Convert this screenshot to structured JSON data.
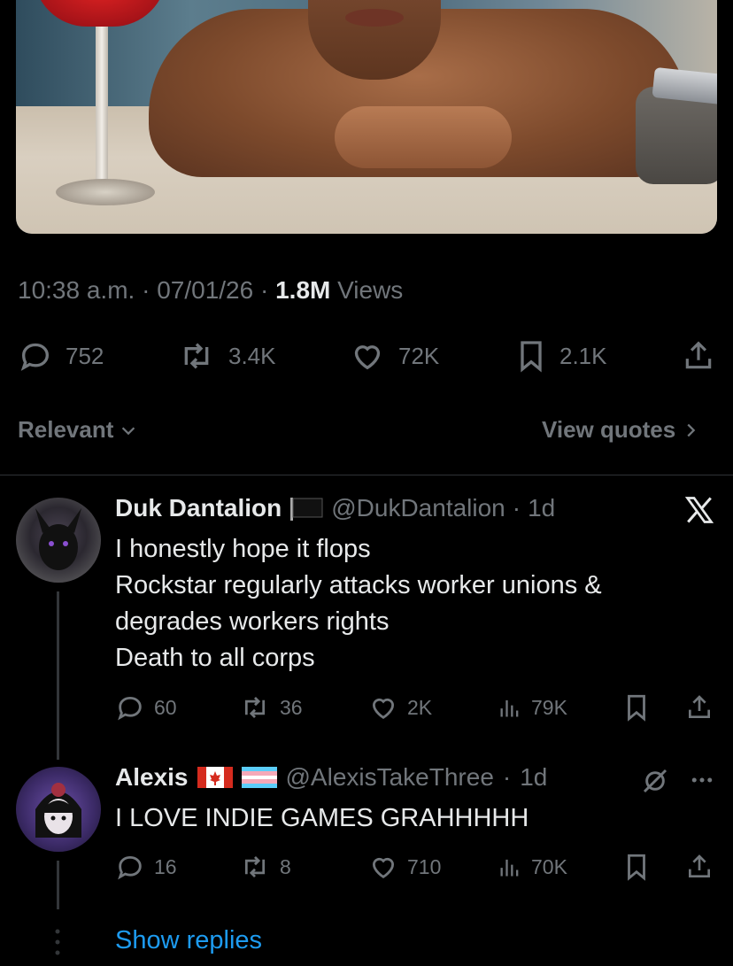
{
  "tweet": {
    "time": "10:38 a.m.",
    "date": "07/01/26",
    "views_count": "1.8M",
    "views_label": "Views",
    "actions": {
      "replies": "752",
      "reposts": "3.4K",
      "likes": "72K",
      "bookmarks": "2.1K"
    }
  },
  "sort": {
    "label": "Relevant",
    "view_quotes": "View quotes"
  },
  "replies": [
    {
      "name": "Duk Dantalion",
      "handle": "@DukDantalion",
      "age": "1d",
      "lines": [
        "I honestly hope it flops",
        "Rockstar regularly attacks worker unions &",
        "degrades workers rights",
        "Death to all corps"
      ],
      "actions": {
        "replies": "60",
        "reposts": "36",
        "likes": "2K",
        "views": "79K"
      }
    },
    {
      "name": "Alexis",
      "handle": "@AlexisTakeThree",
      "age": "1d",
      "lines": [
        "I LOVE INDIE GAMES GRAHHHHH"
      ],
      "actions": {
        "replies": "16",
        "reposts": "8",
        "likes": "710",
        "views": "70K"
      }
    }
  ],
  "show_replies": "Show replies",
  "icons": [
    "reply-icon",
    "repost-icon",
    "like-icon",
    "bookmark-icon",
    "share-icon",
    "views-icon",
    "x-logo-icon",
    "chevron-down-icon",
    "chevron-right-icon",
    "more-icon",
    "grok-icon"
  ],
  "colors": {
    "background": "#000000",
    "muted": "#71767b",
    "text": "#e7e9ea",
    "link": "#1d9bf0"
  }
}
